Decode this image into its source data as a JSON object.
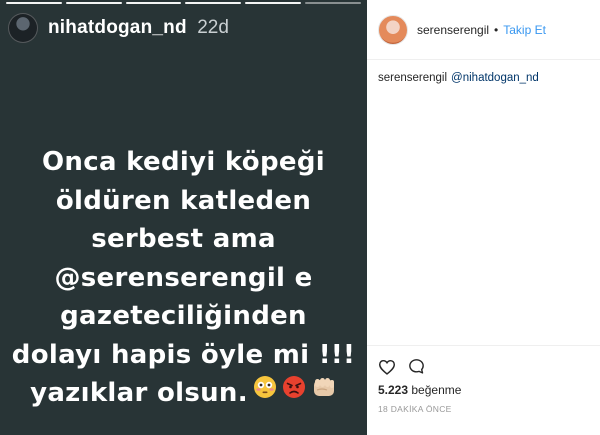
{
  "story": {
    "username": "nihatdogan_nd",
    "age": "22d",
    "lines": [
      "Onca kediyi köpeği",
      "öldüren katleden",
      "serbest ama",
      "@serenserengil e",
      "gazeteciliğinden",
      "dolayı hapis öyle mi !!!",
      "yazıklar olsun."
    ],
    "emojis": [
      "flushed-face-emoji",
      "angry-face-emoji",
      "fist-emoji"
    ],
    "background_color": "#283436"
  },
  "post": {
    "username": "serenserengil",
    "separator": "•",
    "follow_label": "Takip Et",
    "caption_user": "serenserengil",
    "caption_mention": "@nihatdogan_nd",
    "likes_count": "5.223",
    "likes_label": "beğenme",
    "timestamp": "18 DAKİKA ÖNCE",
    "accent_color": "#3897f0"
  }
}
